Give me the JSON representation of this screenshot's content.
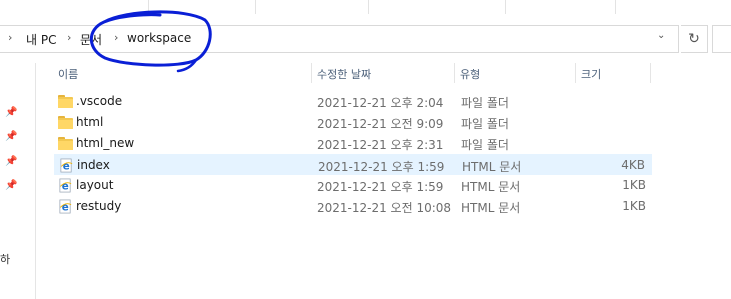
{
  "ribbon": {
    "separators": 5
  },
  "address_bar": {
    "crumbs": [
      "내 PC",
      "문서",
      "workspace"
    ]
  },
  "columns": {
    "name": "이름",
    "date": "수정한 날짜",
    "type": "유형",
    "size": "크기"
  },
  "files": [
    {
      "name": ".vscode",
      "date": "2021-12-21 오후 2:04",
      "type": "파일 폴더",
      "size": "",
      "icon": "folder-icon",
      "selected": false
    },
    {
      "name": "html",
      "date": "2021-12-21 오전 9:09",
      "type": "파일 폴더",
      "size": "",
      "icon": "folder-icon",
      "selected": false
    },
    {
      "name": "html_new",
      "date": "2021-12-21 오후 2:31",
      "type": "파일 폴더",
      "size": "",
      "icon": "folder-icon",
      "selected": false
    },
    {
      "name": "index",
      "date": "2021-12-21 오후 1:59",
      "type": "HTML 문서",
      "size": "4KB",
      "icon": "ie-html-icon",
      "selected": true
    },
    {
      "name": "layout",
      "date": "2021-12-21 오후 1:59",
      "type": "HTML 문서",
      "size": "1KB",
      "icon": "ie-html-icon",
      "selected": false
    },
    {
      "name": "restudy",
      "date": "2021-12-21 오전 10:08",
      "type": "HTML 문서",
      "size": "1KB",
      "icon": "ie-html-icon",
      "selected": false
    }
  ],
  "nav_pane": {
    "partial_label": "하"
  },
  "colors": {
    "selection": "#e5f3ff",
    "folder": "#ffd766",
    "annotation_ink": "#0a1fd6",
    "header_text": "#4c607a"
  }
}
